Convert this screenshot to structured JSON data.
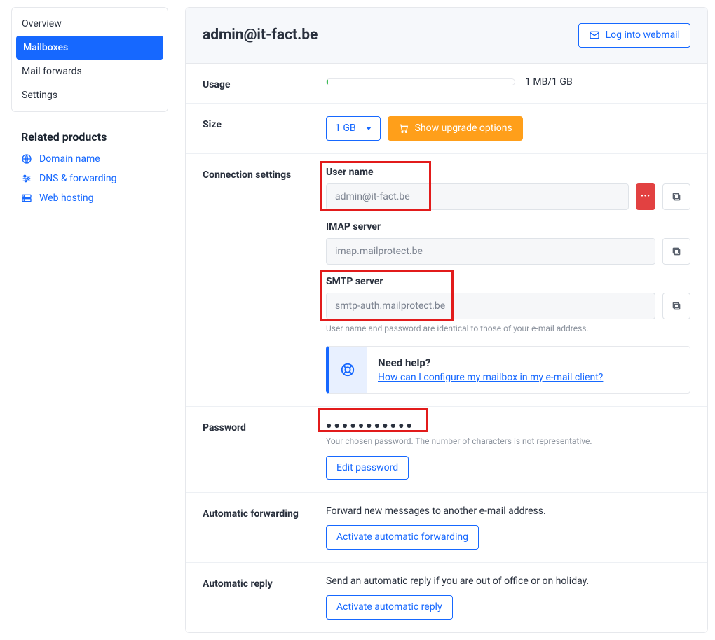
{
  "sidebar": {
    "nav_items": [
      {
        "label": "Overview"
      },
      {
        "label": "Mailboxes"
      },
      {
        "label": "Mail forwards"
      },
      {
        "label": "Settings"
      }
    ],
    "related": {
      "heading": "Related products",
      "items": [
        {
          "label": "Domain name"
        },
        {
          "label": "DNS & forwarding"
        },
        {
          "label": "Web hosting"
        }
      ]
    }
  },
  "header": {
    "title": "admin@it-fact.be",
    "login_button": "Log into webmail"
  },
  "usage": {
    "label": "Usage",
    "text": "1 MB/1 GB"
  },
  "size": {
    "label": "Size",
    "selected": "1 GB",
    "upgrade_button": "Show upgrade options"
  },
  "connection": {
    "label": "Connection settings",
    "username_label": "User name",
    "username_value": "admin@it-fact.be",
    "imap_label": "IMAP server",
    "imap_value": "imap.mailprotect.be",
    "smtp_label": "SMTP server",
    "smtp_value": "smtp-auth.mailprotect.be",
    "hint": "User name and password are identical to those of your e-mail address.",
    "help_title": "Need help?",
    "help_link": "How can I configure my mailbox in my e-mail client?"
  },
  "password": {
    "label": "Password",
    "mask": "●●●●●●●●●●●",
    "hint": "Your chosen password. The number of characters is not representative.",
    "edit_button": "Edit password"
  },
  "forwarding": {
    "label": "Automatic forwarding",
    "desc": "Forward new messages to another e-mail address.",
    "button": "Activate automatic forwarding"
  },
  "reply": {
    "label": "Automatic reply",
    "desc": "Send an automatic reply if you are out of office or on holiday.",
    "button": "Activate automatic reply"
  }
}
